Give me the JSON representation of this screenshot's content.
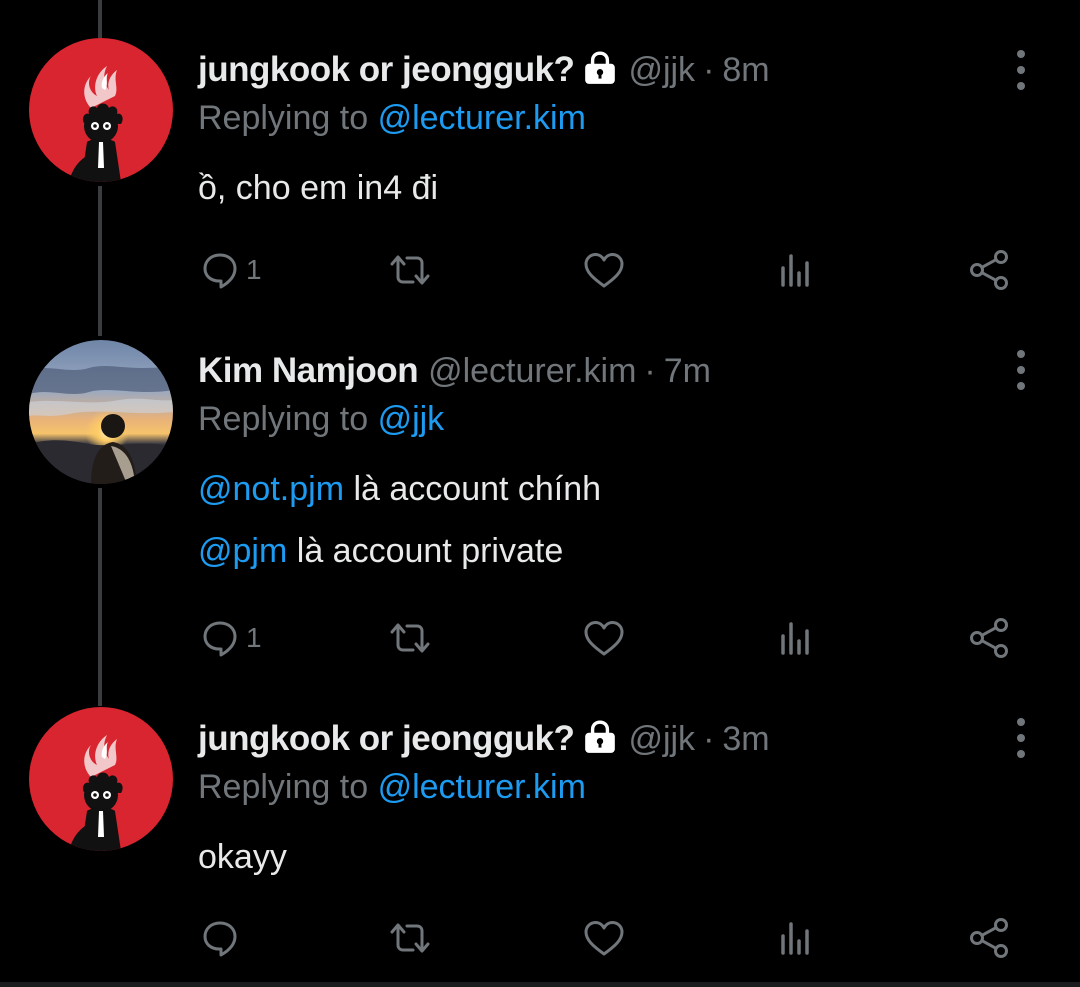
{
  "tweets": [
    {
      "display_name": "jungkook or jeongguk?",
      "protected": true,
      "handle": "@jjk",
      "separator": "·",
      "time": "8m",
      "replying_prefix": "Replying to",
      "replying_to": "@lecturer.kim",
      "lines": [
        {
          "mention": "",
          "text": "ồ, cho em in4 đi"
        }
      ],
      "reply_count": "1",
      "avatar": "red-flame-character-avatar"
    },
    {
      "display_name": "Kim Namjoon",
      "protected": false,
      "handle": "@lecturer.kim",
      "separator": "·",
      "time": "7m",
      "replying_prefix": "Replying to",
      "replying_to": "@jjk",
      "lines": [
        {
          "mention": "@not.pjm",
          "text": " là account chính"
        },
        {
          "mention": "@pjm",
          "text": " là account private"
        }
      ],
      "reply_count": "1",
      "avatar": "sunset-silhouette-avatar"
    },
    {
      "display_name": "jungkook or jeongguk?",
      "protected": true,
      "handle": "@jjk",
      "separator": "·",
      "time": "3m",
      "replying_prefix": "Replying to",
      "replying_to": "@lecturer.kim",
      "lines": [
        {
          "mention": "",
          "text": "okayy"
        }
      ],
      "reply_count": "",
      "avatar": "red-flame-character-avatar"
    }
  ],
  "icons": {
    "reply": "reply-icon",
    "retweet": "retweet-icon",
    "like": "heart-icon",
    "analytics": "analytics-icon",
    "share": "share-icon",
    "more": "more-options-icon",
    "lock": "lock-icon"
  },
  "colors": {
    "background": "#000000",
    "text": "#e7e9ea",
    "secondary": "#71767b",
    "link": "#1d9bf0",
    "avatar_red": "#d9252f",
    "thread_line": "#3a3d40"
  }
}
